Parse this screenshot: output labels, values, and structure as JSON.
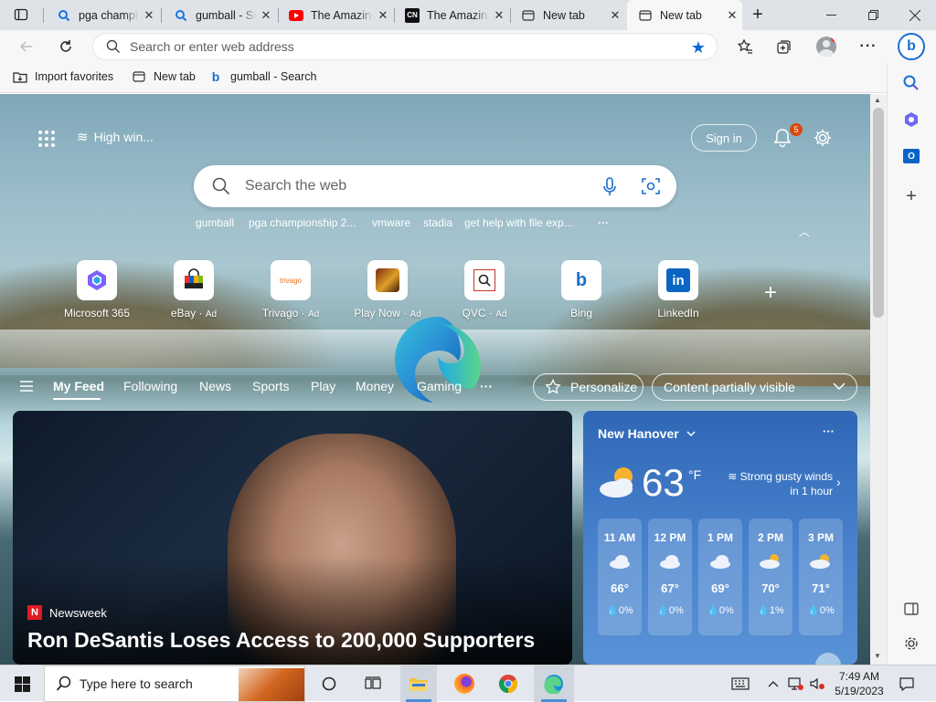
{
  "tabs": [
    {
      "label": "pga championship",
      "icon": "search-icon",
      "icon_color": "#1a73e8"
    },
    {
      "label": "gumball - Search",
      "icon": "search-icon",
      "icon_color": "#1a73e8"
    },
    {
      "label": "The Amazing World of Gumball",
      "icon": "youtube-icon",
      "icon_color": "#ff0000"
    },
    {
      "label": "The Amazing World of Gumball",
      "icon": "cn-icon",
      "icon_color": "#000000"
    },
    {
      "label": "New tab",
      "icon": "newtab-icon",
      "icon_color": "#333333"
    },
    {
      "label": "New tab",
      "icon": "newtab-icon",
      "icon_color": "#333333",
      "active": true
    }
  ],
  "address": {
    "placeholder": "Search or enter web address"
  },
  "favorites": [
    {
      "label": "Import favorites",
      "icon": "import-icon"
    },
    {
      "label": "New tab",
      "icon": "newtab-icon"
    },
    {
      "label": "gumball - Search",
      "icon": "bing-icon"
    }
  ],
  "page": {
    "weather_short": "High win...",
    "sign_in": "Sign in",
    "notif_count": "5",
    "search_placeholder": "Search the web",
    "suggestions": [
      "gumball",
      "pga championship 2...",
      "vmware",
      "stadia",
      "get help with file exp..."
    ],
    "quicklinks": [
      {
        "label": "Microsoft 365",
        "ad": false
      },
      {
        "label": "eBay",
        "ad": true
      },
      {
        "label": "Trivago",
        "ad": true
      },
      {
        "label": "Play Now",
        "ad": true
      },
      {
        "label": "QVC",
        "ad": true
      },
      {
        "label": "Bing",
        "ad": false
      },
      {
        "label": "LinkedIn",
        "ad": false
      }
    ],
    "ad_tag": "Ad",
    "feed_nav": [
      "My Feed",
      "Following",
      "News",
      "Sports",
      "Play",
      "Money",
      "Gaming"
    ],
    "personalize": "Personalize",
    "content_visibility": "Content partially visible"
  },
  "hero": {
    "source": "Newsweek",
    "headline": "Ron DeSantis Loses Access to 200,000 Supporters"
  },
  "weather": {
    "location": "New Hanover",
    "temp": "63",
    "unit": "°F",
    "alert": "Strong gusty winds in 1 hour",
    "hourly": [
      {
        "time": "11 AM",
        "temp": "66°",
        "precip": "0%"
      },
      {
        "time": "12 PM",
        "temp": "67°",
        "precip": "0%"
      },
      {
        "time": "1 PM",
        "temp": "69°",
        "precip": "0%"
      },
      {
        "time": "2 PM",
        "temp": "70°",
        "precip": "1%"
      },
      {
        "time": "3 PM",
        "temp": "71°",
        "precip": "0%"
      }
    ]
  },
  "taskbar": {
    "search_placeholder": "Type here to search",
    "time": "7:49 AM",
    "date": "5/19/2023"
  }
}
